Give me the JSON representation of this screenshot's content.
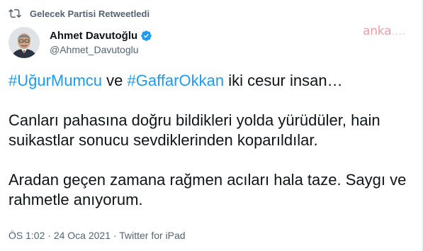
{
  "retweet": {
    "label": "Gelecek Partisi Retweetledi"
  },
  "author": {
    "name": "Ahmet Davutoğlu",
    "handle": "@Ahmet_Davutoglu"
  },
  "watermark": {
    "brand": "anka",
    "dots": "...."
  },
  "tweet": {
    "line1": {
      "hashtag1": "#UğurMumcu",
      "conj": " ve ",
      "hashtag2": "#GaffarOkkan",
      "rest": " iki cesur insan…"
    },
    "line2": "Canları pahasına doğru bildikleri yolda yürüdüler, hain",
    "line3": "suikastlar sonucu sevdiklerinden koparıldılar.",
    "line4": "Aradan geçen zamana rağmen acıları hala taze. Saygı ve",
    "line5": "rahmetle anıyorum."
  },
  "meta": {
    "time": "ÖS 1:02",
    "sep": " · ",
    "date": "24 Oca 2021",
    "source": "Twitter for iPad"
  },
  "colors": {
    "link": "#1d9bf0",
    "secondary": "#536471",
    "verified": "#1d9bf0",
    "watermark": "#e9a0a3"
  },
  "icons": {
    "retweet": "retweet-icon",
    "verified": "verified-badge-icon"
  }
}
